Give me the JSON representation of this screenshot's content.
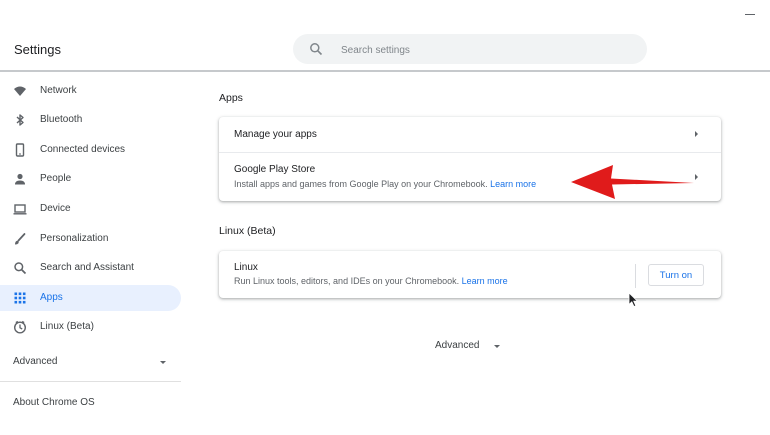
{
  "header": {
    "title": "Settings",
    "search_placeholder": "Search settings"
  },
  "sidebar": {
    "items": [
      {
        "label": "Network",
        "icon": "wifi-icon"
      },
      {
        "label": "Bluetooth",
        "icon": "bluetooth-icon"
      },
      {
        "label": "Connected devices",
        "icon": "phone-icon"
      },
      {
        "label": "People",
        "icon": "person-icon"
      },
      {
        "label": "Device",
        "icon": "laptop-icon"
      },
      {
        "label": "Personalization",
        "icon": "brush-icon"
      },
      {
        "label": "Search and Assistant",
        "icon": "search-icon"
      },
      {
        "label": "Apps",
        "icon": "apps-grid-icon",
        "selected": true
      },
      {
        "label": "Linux (Beta)",
        "icon": "linux-icon"
      }
    ],
    "advanced_label": "Advanced",
    "about_label": "About Chrome OS"
  },
  "main": {
    "apps_section": {
      "title": "Apps",
      "manage_label": "Manage your apps",
      "play_store_title": "Google Play Store",
      "play_store_desc": "Install apps and games from Google Play on your Chromebook.",
      "play_store_link": "Learn more"
    },
    "linux_section": {
      "title": "Linux (Beta)",
      "row_title": "Linux",
      "row_desc": "Run Linux tools, editors, and IDEs on your Chromebook.",
      "row_link": "Learn more",
      "button_label": "Turn on"
    },
    "advanced_label": "Advanced"
  },
  "colors": {
    "accent": "#1a73e8",
    "selected_bg": "#e8f0fe",
    "annotation_arrow": "#e01b1b"
  }
}
